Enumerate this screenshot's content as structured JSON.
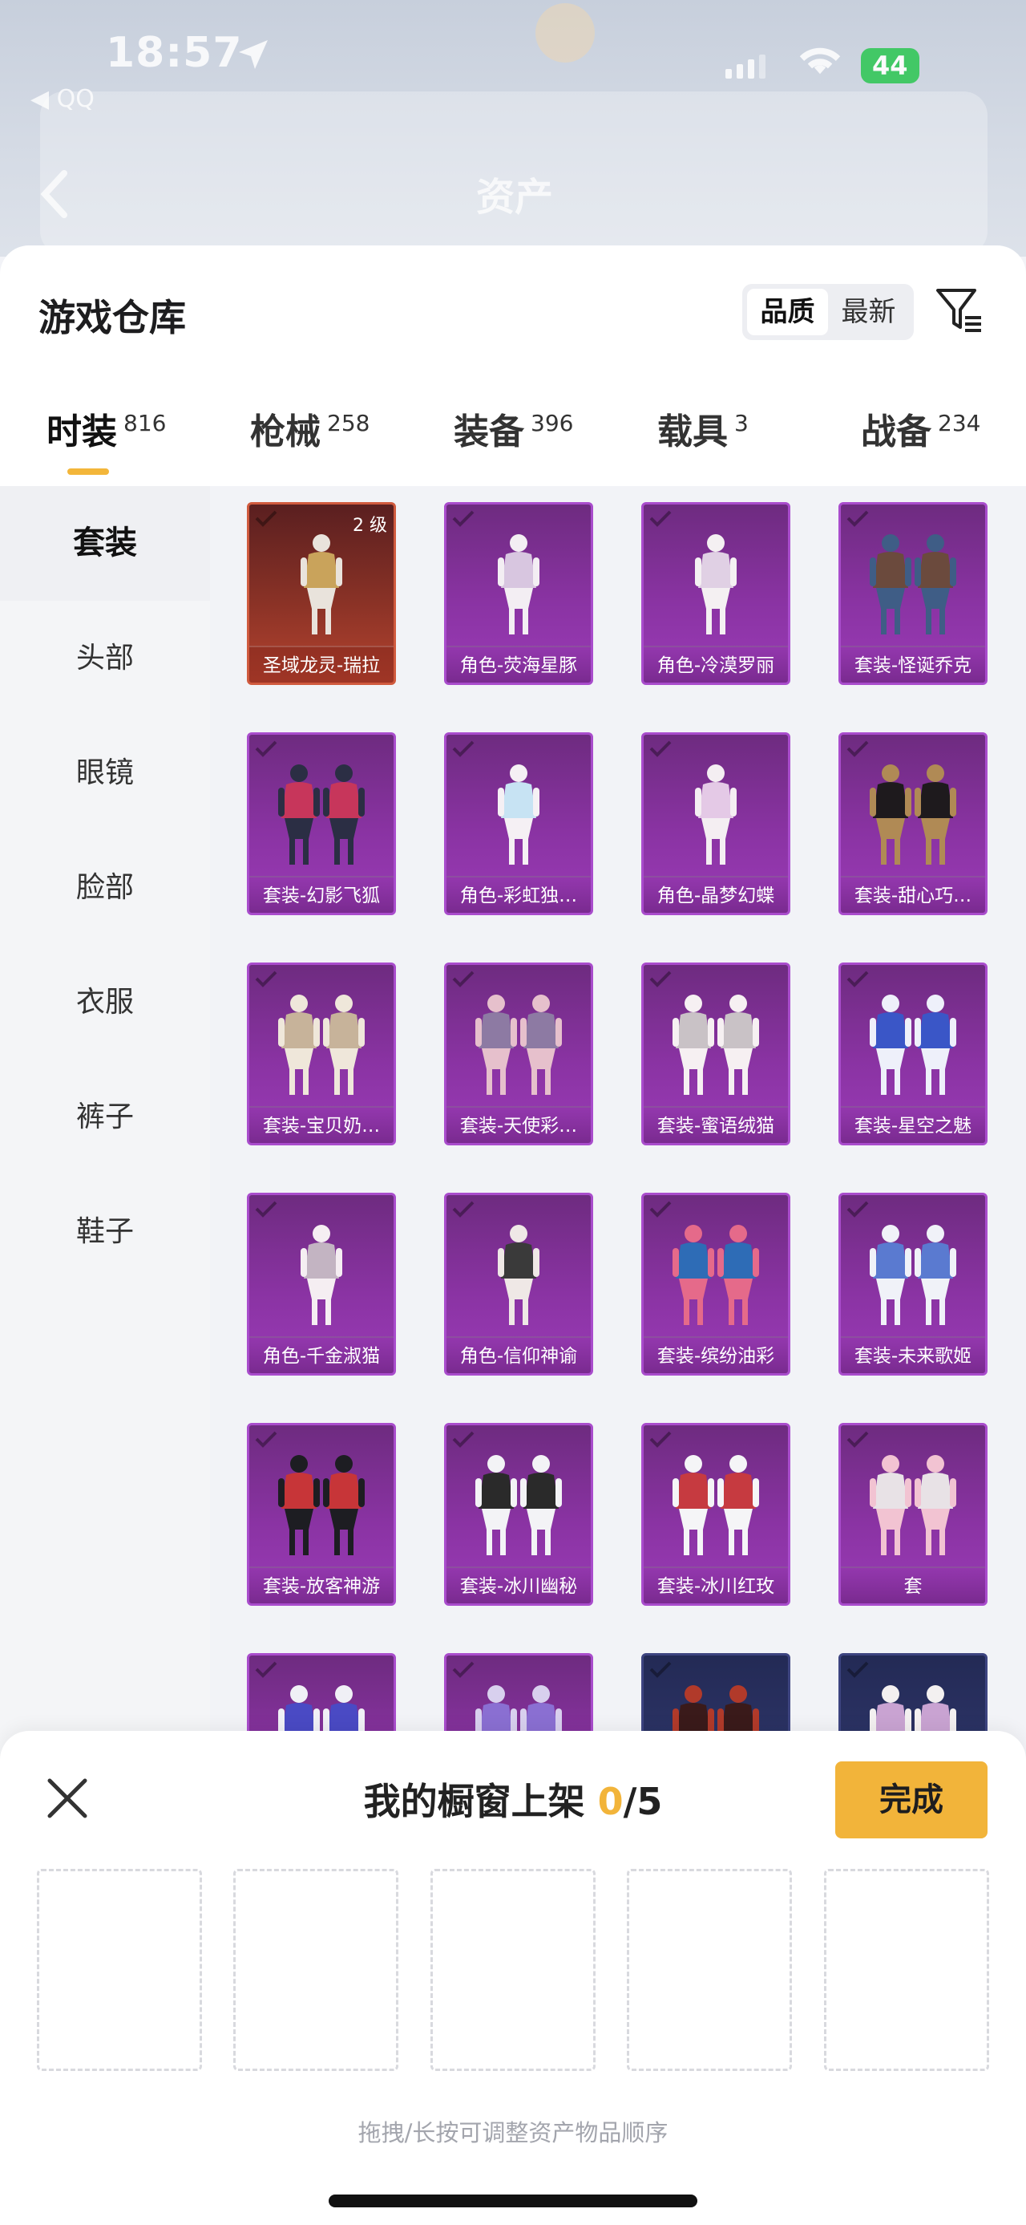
{
  "status_bar": {
    "time": "18:57",
    "battery": "44"
  },
  "nav": {
    "back_text": "◀ QQ",
    "title": "资产"
  },
  "sheet": {
    "title": "游戏仓库",
    "sort_options": [
      "品质",
      "最新"
    ],
    "sort_selected": "品质",
    "filter_icon": "filter-icon"
  },
  "tabs": [
    {
      "label": "时装",
      "count": "816",
      "active": true
    },
    {
      "label": "枪械",
      "count": "258",
      "active": false
    },
    {
      "label": "装备",
      "count": "396",
      "active": false
    },
    {
      "label": "载具",
      "count": "3",
      "active": false
    },
    {
      "label": "战备",
      "count": "234",
      "active": false
    }
  ],
  "sidebar": {
    "items": [
      "套装",
      "头部",
      "眼镜",
      "脸部",
      "衣服",
      "裤子",
      "鞋子"
    ],
    "active": "套装"
  },
  "items": [
    {
      "label": "圣域龙灵-瑞拉",
      "level": "2 级",
      "style": "gold"
    },
    {
      "label": "角色-荧海星豚",
      "style": "purple"
    },
    {
      "label": "角色-冷漠罗丽",
      "style": "purple"
    },
    {
      "label": "套装-怪诞乔克",
      "style": "purple"
    },
    {
      "label": "套装-幻影飞狐",
      "style": "purple"
    },
    {
      "label": "角色-彩虹独…",
      "style": "purple"
    },
    {
      "label": "角色-晶梦幻蝶",
      "style": "purple"
    },
    {
      "label": "套装-甜心巧…",
      "style": "purple"
    },
    {
      "label": "套装-宝贝奶…",
      "style": "purple"
    },
    {
      "label": "套装-天使彩…",
      "style": "purple"
    },
    {
      "label": "套装-蜜语绒猫",
      "style": "purple"
    },
    {
      "label": "套装-星空之魅",
      "style": "purple"
    },
    {
      "label": "角色-千金淑猫",
      "style": "purple"
    },
    {
      "label": "角色-信仰神谕",
      "style": "purple"
    },
    {
      "label": "套装-缤纷油彩",
      "style": "purple"
    },
    {
      "label": "套装-未来歌姬",
      "style": "purple"
    },
    {
      "label": "套装-放客神游",
      "style": "purple"
    },
    {
      "label": "套装-冰川幽秘",
      "style": "purple"
    },
    {
      "label": "套装-冰川红玫",
      "style": "purple"
    },
    {
      "label": "套",
      "style": "purple"
    },
    {
      "label": "",
      "style": "purple"
    },
    {
      "label": "",
      "style": "purple"
    },
    {
      "label": "",
      "style": "dark"
    },
    {
      "label": "",
      "style": "dark"
    }
  ],
  "fab": {
    "icon": "share-external-icon"
  },
  "showcase": {
    "title_prefix": "我的橱窗上架",
    "current": "0",
    "max": "/5",
    "done_label": "完成",
    "slots": 5,
    "hint": "拖拽/长按可调整资产物品顺序"
  },
  "colors": {
    "accent": "#f2b43a",
    "purple_card": "#8a33a3",
    "gold_card": "#b4432f"
  }
}
